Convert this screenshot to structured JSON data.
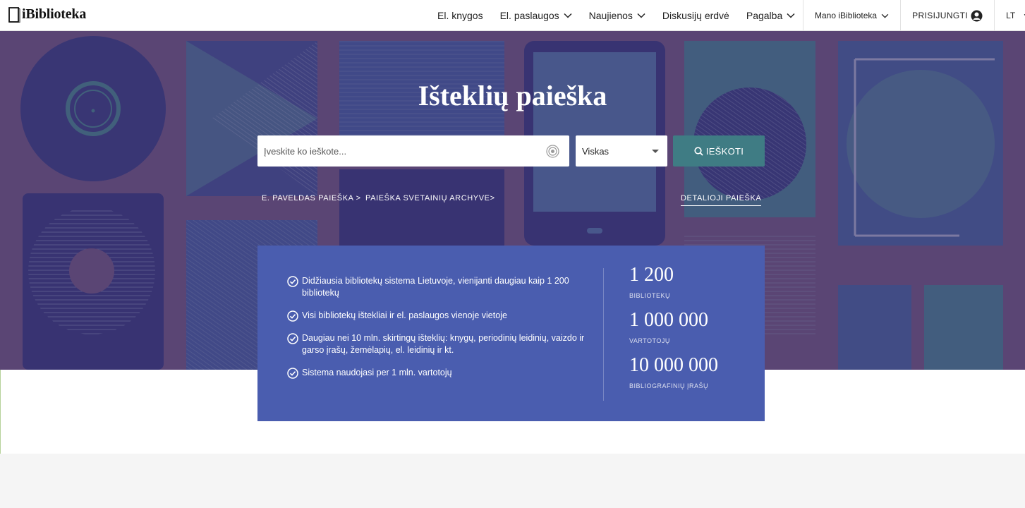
{
  "brand": {
    "name": "iBiblioteka"
  },
  "nav": {
    "items": [
      {
        "label": "El. knygos",
        "has_dropdown": false
      },
      {
        "label": "El. paslaugos",
        "has_dropdown": true
      },
      {
        "label": "Naujienos",
        "has_dropdown": true
      },
      {
        "label": "Diskusijų erdvė",
        "has_dropdown": false
      },
      {
        "label": "Pagalba",
        "has_dropdown": true
      }
    ],
    "account": "Mano iBiblioteka",
    "login": "PRISIJUNGTI",
    "language": "LT"
  },
  "hero": {
    "title": "Išteklių paieška",
    "search_placeholder": "Įveskite ko ieškote...",
    "scope_selected": "Viskas",
    "search_button": "IEŠKOTI",
    "links": {
      "epaveldas": "E. PAVELDAS PAIEŠKA >",
      "archive": "PAIEŠKA SVETAINIŲ ARCHYVE>",
      "detailed": "DETALIOJI PAIEŠKA"
    }
  },
  "info": {
    "features": [
      "Didžiausia bibliotekų sistema Lietuvoje, vienijanti daugiau kaip 1 200 bibliotekų",
      "Visi bibliotekų ištekliai ir el. paslaugos vienoje vietoje",
      "Daugiau nei 10 mln. skirtingų išteklių: knygų, periodinių leidinių, vaizdo ir garso įrašų, žemėlapių, el. leidinių ir kt.",
      "Sistema naudojasi per 1 mln. vartotojų"
    ],
    "stats": [
      {
        "value": "1 200",
        "label": "BIBLIOTEKŲ"
      },
      {
        "value": "1 000 000",
        "label": "VARTOTOJŲ"
      },
      {
        "value": "10 000 000",
        "label": "BIBLIOGRAFINIŲ ĮRAŠŲ"
      }
    ]
  },
  "colors": {
    "info_bg": "#4a5daf",
    "search_button": "#3f7c84",
    "hero_tint": "#5c4775"
  }
}
